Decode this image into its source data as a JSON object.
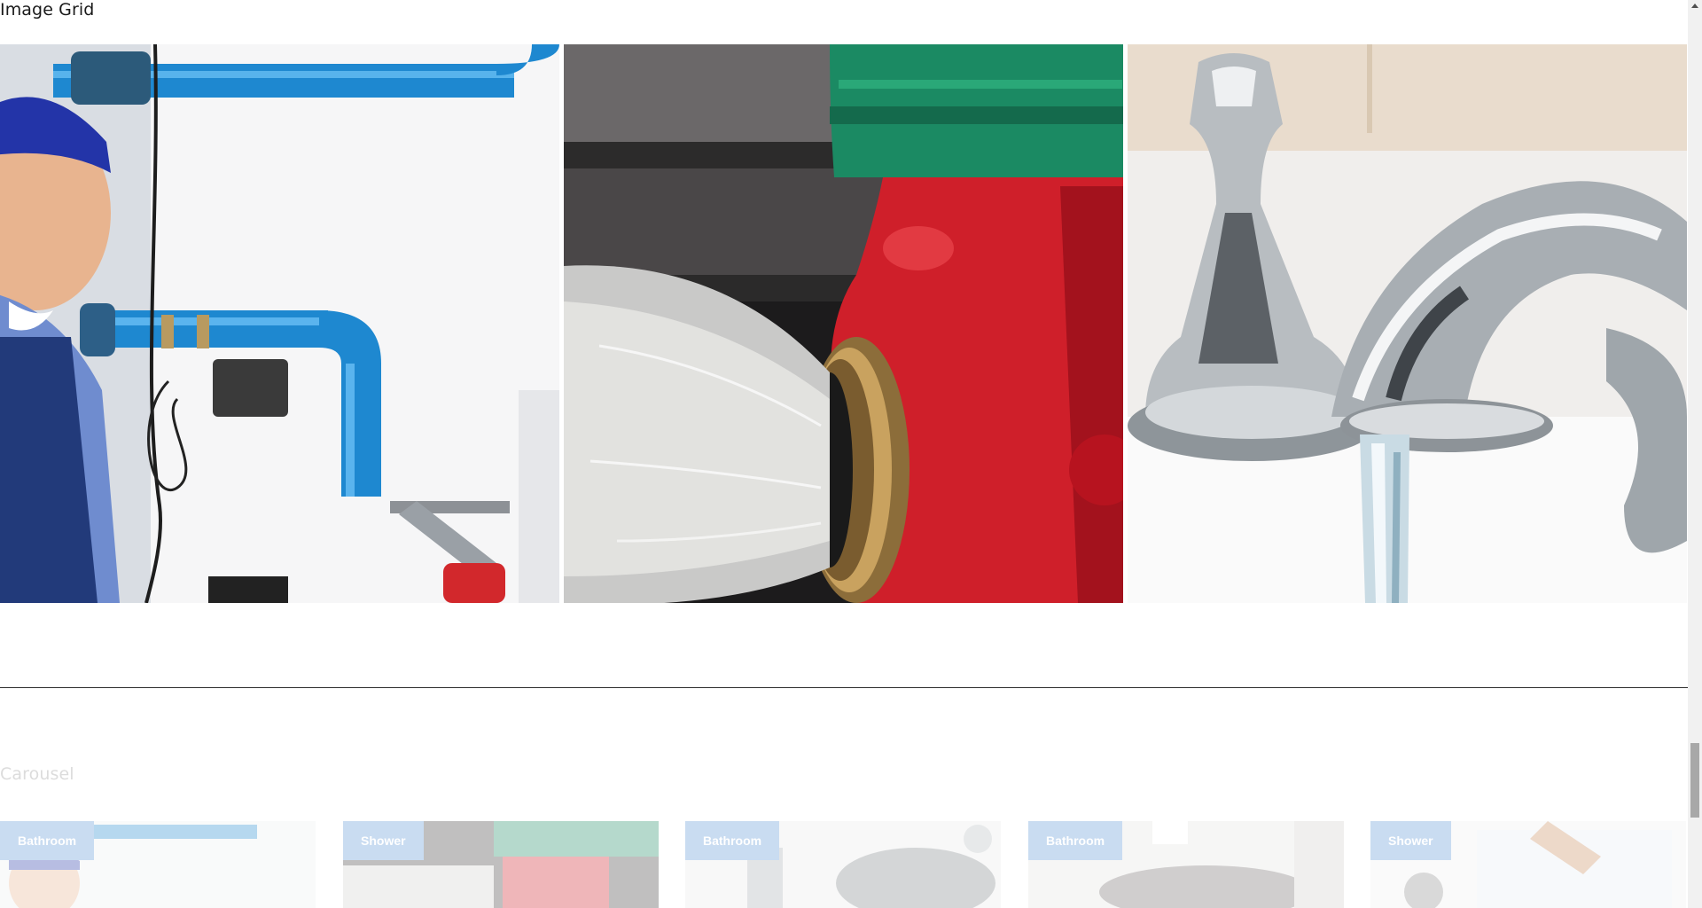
{
  "image_grid": {
    "title": "Image Grid",
    "images": [
      {
        "name": "plumber-with-pipes-image"
      },
      {
        "name": "fire-hydrant-image"
      },
      {
        "name": "chrome-faucet-image"
      }
    ]
  },
  "carousel": {
    "title": "Carousel",
    "items": [
      {
        "tag": "Bathroom"
      },
      {
        "tag": "Shower"
      },
      {
        "tag": "Bathroom"
      },
      {
        "tag": "Bathroom"
      },
      {
        "tag": "Shower"
      }
    ]
  },
  "colors": {
    "tag_background": "#5a95d6",
    "divider": "#2d2d2d",
    "pipe_blue": "#1e88d0",
    "hydrant_red": "#cf1f2a",
    "hydrant_green": "#1b8a63"
  }
}
